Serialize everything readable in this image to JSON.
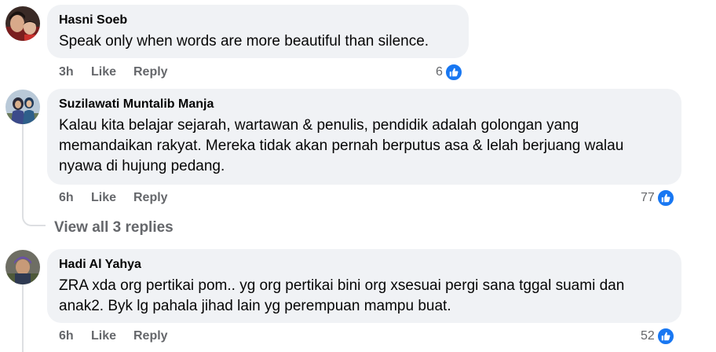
{
  "comments": [
    {
      "author": "Hasni Soeb",
      "text": "Speak only when words are more beautiful than silence.",
      "time": "3h",
      "like_label": "Like",
      "reply_label": "Reply",
      "reaction_count": "6",
      "reaction_icon": "like-icon"
    },
    {
      "author": "Suzilawati Muntalib Manja",
      "text_lines": [
        "Kalau kita belajar sejarah, wartawan & penulis, pendidik adalah golongan yang",
        "memandaikan rakyat. Mereka tidak akan pernah berputus asa & lelah berjuang walau",
        "nyawa di hujung pedang."
      ],
      "time": "6h",
      "like_label": "Like",
      "reply_label": "Reply",
      "reaction_count": "77",
      "reaction_icon": "like-icon",
      "view_replies_label": "View all 3 replies"
    },
    {
      "author": "Hadi Al Yahya",
      "text_lines": [
        "ZRA xda org pertikai pom.. yg org pertikai bini org xsesuai pergi sana tggal suami dan",
        "anak2. Byk lg pahala jihad lain yg perempuan mampu buat."
      ],
      "time": "6h",
      "like_label": "Like",
      "reply_label": "Reply",
      "reaction_count": "52",
      "reaction_icon": "like-icon"
    }
  ],
  "colors": {
    "bubble": "#f0f2f5",
    "meta_text": "#65676b",
    "like_blue": "#1877f2",
    "thread_line": "#dddfe2"
  }
}
